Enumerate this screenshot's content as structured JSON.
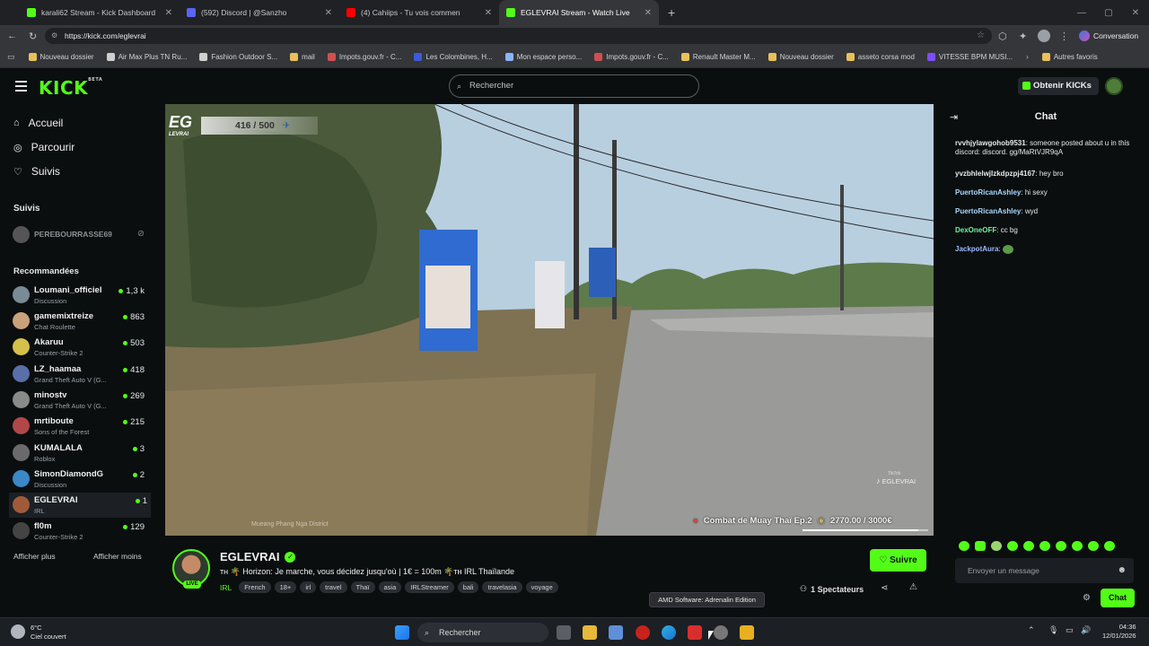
{
  "browser": {
    "tabs": [
      {
        "title": "karali62 Stream - Kick Dashboard",
        "color": "#53fc18",
        "active": false
      },
      {
        "title": "(592) Discord | @Sanzho",
        "color": "#5865f2",
        "active": false
      },
      {
        "title": "(4) Cahiips - Tu vois commen",
        "color": "#ff0000",
        "active": false
      },
      {
        "title": "EGLEVRAI Stream - Watch Live",
        "color": "#53fc18",
        "active": true
      }
    ],
    "new_tab": "+",
    "url": "https://kick.com/eglevrai",
    "conversation_label": "Conversation",
    "bookmarks": [
      "Nouveau dossier",
      "Air Max Plus TN Ru...",
      "Fashion Outdoor S...",
      "mail",
      "Impots.gouv.fr - C...",
      "Les Colombines, H...",
      "Mon espace perso...",
      "Impots.gouv.fr - C...",
      "Renault Master M...",
      "Nouveau dossier",
      "asseto corsa mod",
      "VITESSE BPM MUSI..."
    ],
    "other_favorites": "Autres favoris"
  },
  "header": {
    "logo": "KICK",
    "logo_sup": "BETA",
    "search_placeholder": "Rechercher",
    "get_kicks": "Obtenir KICKs"
  },
  "sidebar": {
    "nav": [
      {
        "label": "Accueil",
        "icon": "home-icon"
      },
      {
        "label": "Parcourir",
        "icon": "compass-icon"
      },
      {
        "label": "Suivis",
        "icon": "heart-icon"
      }
    ],
    "followed_title": "Suivis",
    "followed": [
      {
        "name": "PEREBOURRASSE69",
        "offline": true
      }
    ],
    "recommended_title": "Recommandées",
    "recommended": [
      {
        "name": "Loumani_officiel",
        "category": "Discussion",
        "viewers": "1,3 k",
        "color": "#7a8a96"
      },
      {
        "name": "gamemixtreize",
        "category": "Chat Roulette",
        "viewers": "863",
        "color": "#c9a27a"
      },
      {
        "name": "Akaruu",
        "category": "Counter-Strike 2",
        "viewers": "503",
        "color": "#d4c04a"
      },
      {
        "name": "LZ_haamaa",
        "category": "Grand Theft Auto V (G...",
        "viewers": "418",
        "color": "#5a6ea8"
      },
      {
        "name": "minostv",
        "category": "Grand Theft Auto V (G...",
        "viewers": "269",
        "color": "#8a8a8a"
      },
      {
        "name": "mrtiboute",
        "category": "Sons of the Forest",
        "viewers": "215",
        "color": "#b04848"
      },
      {
        "name": "KUMALALA",
        "category": "Roblox",
        "viewers": "3",
        "color": "#6a6a6a"
      },
      {
        "name": "SimonDiamondG",
        "category": "Discussion",
        "viewers": "2",
        "color": "#3a88c8"
      },
      {
        "name": "EGLEVRAI",
        "category": "IRL",
        "viewers": "1",
        "color": "#a05a3a"
      },
      {
        "name": "fl0m",
        "category": "Counter-Strike 2",
        "viewers": "129",
        "color": "#444444"
      }
    ],
    "show_more": "Afficher plus",
    "show_less": "Afficher moins"
  },
  "video": {
    "goal_count": "416 / 500",
    "overlay_logo": "EG",
    "overlay_logo_sub": "LEVRAI",
    "goal_text": "Combat de Muay Thaï Ep.2",
    "goal_amount": "2770.00 / 3000€",
    "watermark_top": "TikTok",
    "watermark": "EGLEVRAI",
    "location": "Mueang Phang Nga District"
  },
  "stream": {
    "streamer": "EGLEVRAI",
    "title": "ᴛʜ 🌴 Horizon: Je marche, vous décidez jusqu'où | 1€ = 100m 🌴ᴛʜ IRL Thaïlande",
    "category": "IRL",
    "tags": [
      "French",
      "18+",
      "irl",
      "travel",
      "Thaï",
      "asia",
      "IRLStreamer",
      "bali",
      "travelasia",
      "voyage"
    ],
    "follow_label": "Suivre",
    "viewers": "1 Spectateurs"
  },
  "chat": {
    "title": "Chat",
    "messages": [
      {
        "user": "rvvhjylawgohob9531",
        "text": "someone posted about u in this discord: discord. gg/MaRtVJR9qA",
        "color": "#e6e8ea"
      },
      {
        "user": "yvzbhlelwjlzkdpzpj4167",
        "text": "hey bro",
        "color": "#e6e8ea"
      },
      {
        "user": "PuertoRicanAshley",
        "text": "hi sexy",
        "color": "#a8d8ff"
      },
      {
        "user": "PuertoRicanAshley",
        "text": "wyd",
        "color": "#a8d8ff"
      },
      {
        "user": "DexOneOFF",
        "text": "cc bg",
        "color": "#75f0a4"
      },
      {
        "user": "JackpotAura",
        "text": "",
        "color": "#9ab8ff"
      }
    ],
    "input_placeholder": "Envoyer un message",
    "send_label": "Chat",
    "tooltip": "AMD Software: Adrenalin Edition"
  },
  "taskbar": {
    "weather_temp": "6°C",
    "weather_desc": "Ciel couvert",
    "search_placeholder": "Rechercher",
    "time": "04:36",
    "date": "12/01/2026"
  },
  "colors": {
    "kick_green": "#53fc18",
    "bg": "#0b0e0f"
  }
}
